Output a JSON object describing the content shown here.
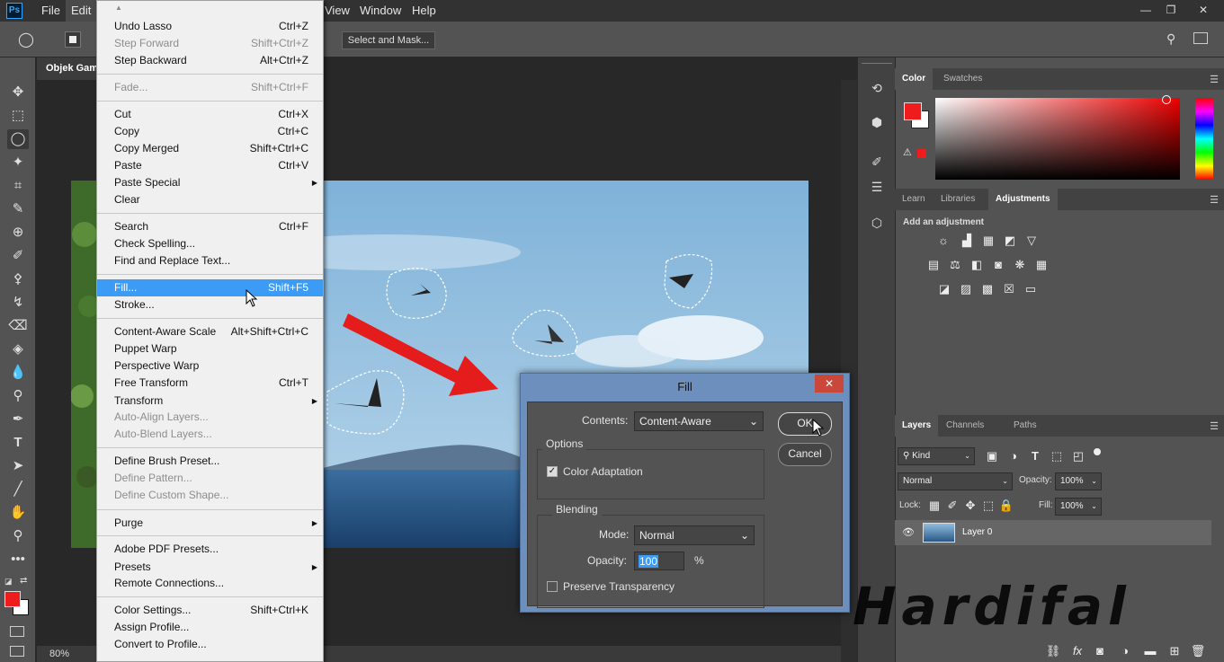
{
  "app": {
    "logo": "Ps"
  },
  "menubar": {
    "items": [
      "File",
      "Edit",
      "View",
      "Window",
      "Help"
    ],
    "active": "Edit"
  },
  "options_bar": {
    "select_mask": "Select and Mask..."
  },
  "document": {
    "tab_title": "Objek Gam",
    "zoom": "80%"
  },
  "edit_menu": {
    "items": [
      {
        "label": "Undo Lasso",
        "shortcut": "Ctrl+Z",
        "enabled": true
      },
      {
        "label": "Step Forward",
        "shortcut": "Shift+Ctrl+Z",
        "enabled": false
      },
      {
        "label": "Step Backward",
        "shortcut": "Alt+Ctrl+Z",
        "enabled": true
      },
      {
        "label": "Fade...",
        "shortcut": "Shift+Ctrl+F",
        "enabled": false
      },
      {
        "label": "Cut",
        "shortcut": "Ctrl+X",
        "enabled": true
      },
      {
        "label": "Copy",
        "shortcut": "Ctrl+C",
        "enabled": true
      },
      {
        "label": "Copy Merged",
        "shortcut": "Shift+Ctrl+C",
        "enabled": true
      },
      {
        "label": "Paste",
        "shortcut": "Ctrl+V",
        "enabled": true
      },
      {
        "label": "Paste Special",
        "shortcut": "",
        "enabled": true,
        "submenu": true
      },
      {
        "label": "Clear",
        "shortcut": "",
        "enabled": true
      },
      {
        "label": "Search",
        "shortcut": "Ctrl+F",
        "enabled": true
      },
      {
        "label": "Check Spelling...",
        "shortcut": "",
        "enabled": true
      },
      {
        "label": "Find and Replace Text...",
        "shortcut": "",
        "enabled": true
      },
      {
        "label": "Fill...",
        "shortcut": "Shift+F5",
        "enabled": true,
        "highlighted": true
      },
      {
        "label": "Stroke...",
        "shortcut": "",
        "enabled": true
      },
      {
        "label": "Content-Aware Scale",
        "shortcut": "Alt+Shift+Ctrl+C",
        "enabled": true
      },
      {
        "label": "Puppet Warp",
        "shortcut": "",
        "enabled": true
      },
      {
        "label": "Perspective Warp",
        "shortcut": "",
        "enabled": true
      },
      {
        "label": "Free Transform",
        "shortcut": "Ctrl+T",
        "enabled": true
      },
      {
        "label": "Transform",
        "shortcut": "",
        "enabled": true,
        "submenu": true
      },
      {
        "label": "Auto-Align Layers...",
        "shortcut": "",
        "enabled": false
      },
      {
        "label": "Auto-Blend Layers...",
        "shortcut": "",
        "enabled": false
      },
      {
        "label": "Define Brush Preset...",
        "shortcut": "",
        "enabled": true
      },
      {
        "label": "Define Pattern...",
        "shortcut": "",
        "enabled": false
      },
      {
        "label": "Define Custom Shape...",
        "shortcut": "",
        "enabled": false
      },
      {
        "label": "Purge",
        "shortcut": "",
        "enabled": true,
        "submenu": true
      },
      {
        "label": "Adobe PDF Presets...",
        "shortcut": "",
        "enabled": true
      },
      {
        "label": "Presets",
        "shortcut": "",
        "enabled": true,
        "submenu": true
      },
      {
        "label": "Remote Connections...",
        "shortcut": "",
        "enabled": true
      },
      {
        "label": "Color Settings...",
        "shortcut": "Shift+Ctrl+K",
        "enabled": true
      },
      {
        "label": "Assign Profile...",
        "shortcut": "",
        "enabled": true
      },
      {
        "label": "Convert to Profile...",
        "shortcut": "",
        "enabled": true
      }
    ]
  },
  "color_panel": {
    "tabs": [
      "Color",
      "Swatches"
    ],
    "fg": "#ee1c1c",
    "bg": "#ffffff"
  },
  "adjust_panel": {
    "tabs": [
      "Learn",
      "Libraries",
      "Adjustments"
    ],
    "heading": "Add an adjustment"
  },
  "layers_panel": {
    "tabs": [
      "Layers",
      "Channels",
      "Paths"
    ],
    "filter": "Kind",
    "blend": "Normal",
    "opacity_label": "Opacity:",
    "opacity": "100%",
    "lock_label": "Lock:",
    "fill_label": "Fill:",
    "fill": "100%",
    "layer_name": "Layer 0"
  },
  "fill_dialog": {
    "title": "Fill",
    "contents_label": "Contents:",
    "contents_value": "Content-Aware",
    "options_title": "Options",
    "color_adaptation": "Color Adaptation",
    "color_adaptation_checked": true,
    "blending_title": "Blending",
    "mode_label": "Mode:",
    "mode_value": "Normal",
    "opacity_label": "Opacity:",
    "opacity_value": "100",
    "percent": "%",
    "preserve": "Preserve Transparency",
    "ok": "OK",
    "cancel": "Cancel"
  },
  "watermark": "Hardifal",
  "colors": {
    "accent": "#3c9cf5",
    "fg_swatch": "#ee1c1c"
  }
}
